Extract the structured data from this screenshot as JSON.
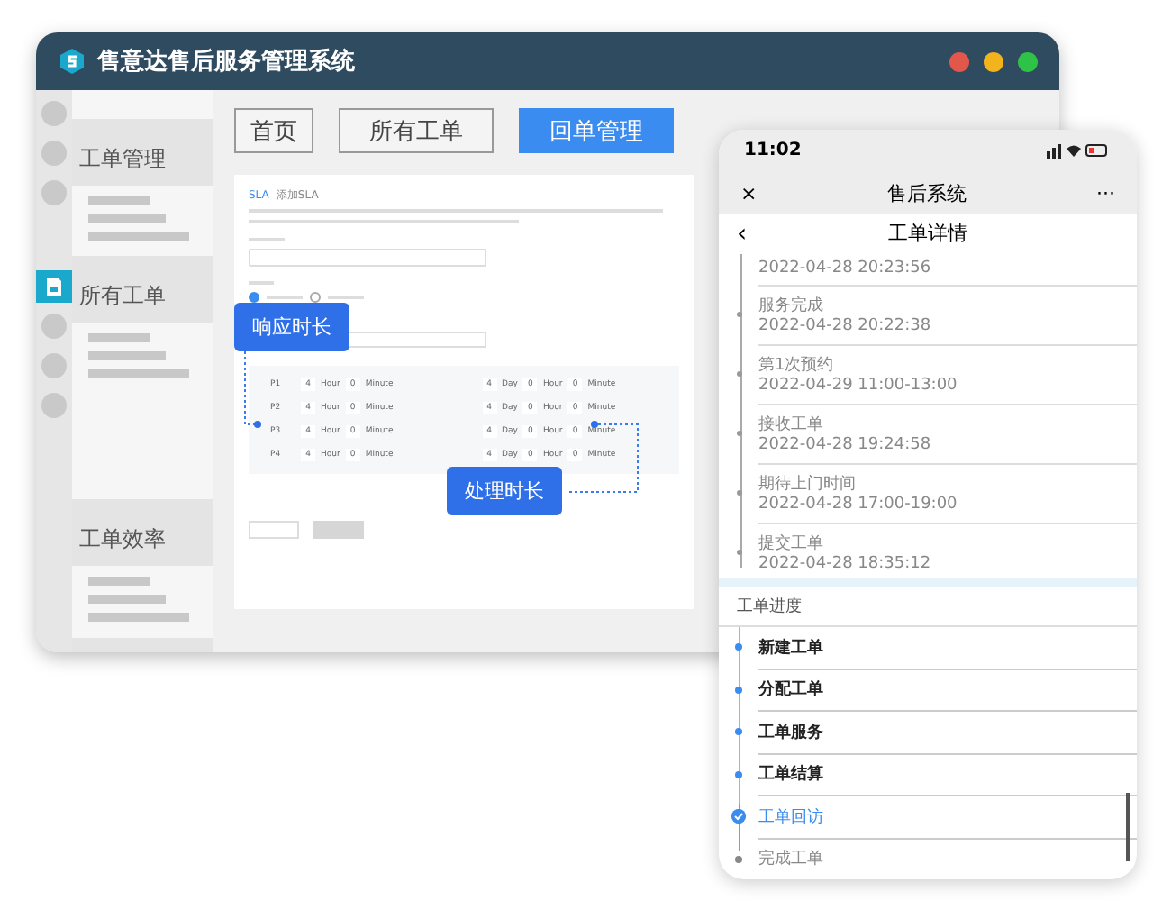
{
  "window": {
    "title": "售意达售后服务管理系统"
  },
  "rail": {
    "items": [
      {
        "selected": false
      },
      {
        "selected": false
      },
      {
        "selected": false
      },
      {
        "selected": true
      },
      {
        "selected": false
      },
      {
        "selected": false
      },
      {
        "selected": false
      }
    ]
  },
  "sidebar": {
    "sections": [
      {
        "label": "工单管理"
      },
      {
        "label": "所有工单"
      },
      {
        "label": "工单效率"
      }
    ]
  },
  "tabs": [
    {
      "label": "首页",
      "selected": false
    },
    {
      "label": "所有工单",
      "selected": false
    },
    {
      "label": "回单管理",
      "selected": true
    }
  ],
  "form": {
    "breadcrumb": [
      "SLA",
      "添加SLA"
    ],
    "radios": [
      {
        "selected": true
      },
      {
        "selected": false
      }
    ],
    "rows": [
      {
        "label": "P1",
        "response": [
          {
            "value": "4",
            "unit": "Hour"
          },
          {
            "value": "0",
            "unit": "Minute"
          }
        ],
        "resolve": [
          {
            "value": "4",
            "unit": "Day"
          },
          {
            "value": "0",
            "unit": "Hour"
          },
          {
            "value": "0",
            "unit": "Minute"
          }
        ]
      },
      {
        "label": "P2",
        "response": [
          {
            "value": "4",
            "unit": "Hour"
          },
          {
            "value": "0",
            "unit": "Minute"
          }
        ],
        "resolve": [
          {
            "value": "4",
            "unit": "Day"
          },
          {
            "value": "0",
            "unit": "Hour"
          },
          {
            "value": "0",
            "unit": "Minute"
          }
        ]
      },
      {
        "label": "P3",
        "response": [
          {
            "value": "4",
            "unit": "Hour"
          },
          {
            "value": "0",
            "unit": "Minute"
          }
        ],
        "resolve": [
          {
            "value": "4",
            "unit": "Day"
          },
          {
            "value": "0",
            "unit": "Hour"
          },
          {
            "value": "0",
            "unit": "Minute"
          }
        ]
      },
      {
        "label": "P4",
        "response": [
          {
            "value": "4",
            "unit": "Hour"
          },
          {
            "value": "0",
            "unit": "Minute"
          }
        ],
        "resolve": [
          {
            "value": "4",
            "unit": "Day"
          },
          {
            "value": "0",
            "unit": "Hour"
          },
          {
            "value": "0",
            "unit": "Minute"
          }
        ]
      }
    ],
    "callouts": [
      "响应时长",
      "处理时长"
    ]
  },
  "phone": {
    "time": "11:02",
    "nav_title": "售后系统",
    "close": "×",
    "more": "···",
    "back": "‹",
    "page_title": "工单详情",
    "timeline": [
      {
        "time": "2022-04-28 20:23:56"
      },
      {
        "title": "服务完成",
        "time": "2022-04-28 20:22:38"
      },
      {
        "title": "第1次预约",
        "time": "2022-04-29 11:00-13:00"
      },
      {
        "title": "接收工单",
        "time": "2022-04-28 19:24:58"
      },
      {
        "title": "期待上门时间",
        "time": "2022-04-28 17:00-19:00"
      },
      {
        "title": "提交工单",
        "time": "2022-04-28 18:35:12"
      }
    ],
    "progress_title": "工单进度",
    "progress": [
      {
        "label": "新建工单",
        "kind": "done"
      },
      {
        "label": "分配工单",
        "kind": "done"
      },
      {
        "label": "工单服务",
        "kind": "done"
      },
      {
        "label": "工单结算",
        "kind": "done"
      },
      {
        "label": "工单回访",
        "kind": "current"
      },
      {
        "label": "完成工单",
        "kind": "pending"
      }
    ]
  }
}
